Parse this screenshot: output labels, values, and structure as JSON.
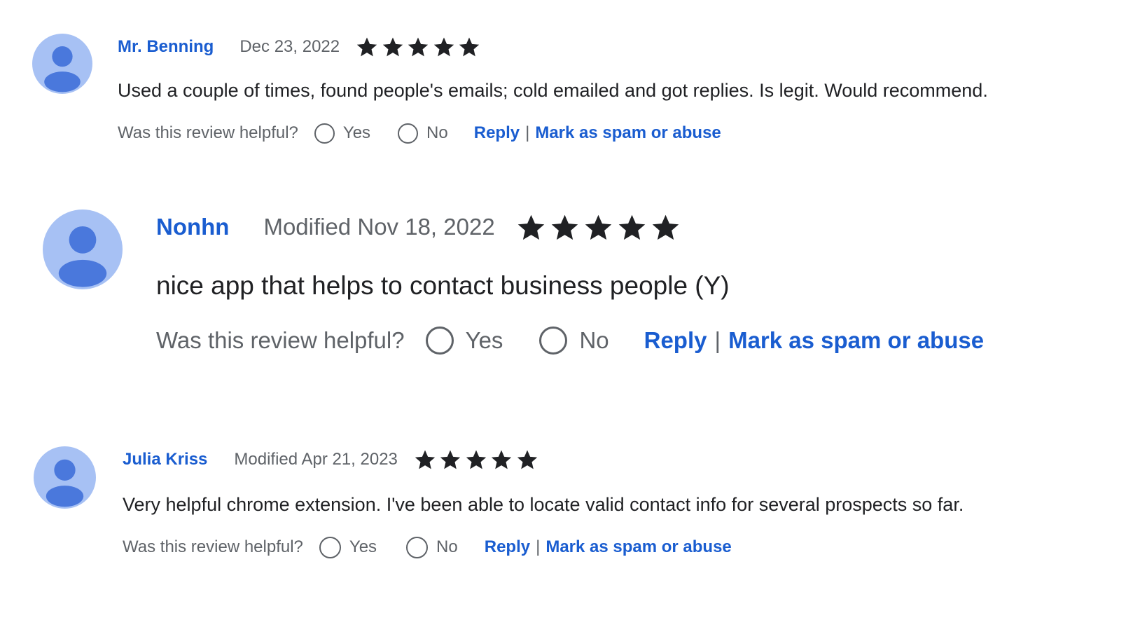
{
  "colors": {
    "link": "#1a5dd0",
    "avatar_bg": "#a7c1f4",
    "avatar_figure": "#4a78dc",
    "muted_text": "#5f6368",
    "body_text": "#202124"
  },
  "icons": {
    "avatar": "person-silhouette-icon",
    "star": "filled-star-icon",
    "radio": "radio-circle-icon"
  },
  "reviews": [
    {
      "author": "Mr. Benning",
      "date": "Dec 23, 2022",
      "rating": 5,
      "text": "Used a couple of times, found people's emails; cold emailed and got replies. Is legit. Would recommend.",
      "helpful_prompt": "Was this review helpful?",
      "yes_label": "Yes",
      "no_label": "No",
      "reply_label": "Reply",
      "separator": "|",
      "spam_label": "Mark as spam or abuse"
    },
    {
      "author": "Nonhn",
      "date": "Modified Nov 18, 2022",
      "rating": 5,
      "text": "nice app that helps to contact business people (Y)",
      "helpful_prompt": "Was this review helpful?",
      "yes_label": "Yes",
      "no_label": "No",
      "reply_label": "Reply",
      "separator": "|",
      "spam_label": "Mark as spam or abuse"
    },
    {
      "author": "Julia Kriss",
      "date": "Modified Apr 21, 2023",
      "rating": 5,
      "text": "Very helpful chrome extension. I've been able to locate valid contact info for several prospects so far.",
      "helpful_prompt": "Was this review helpful?",
      "yes_label": "Yes",
      "no_label": "No",
      "reply_label": "Reply",
      "separator": "|",
      "spam_label": "Mark as spam or abuse"
    }
  ]
}
